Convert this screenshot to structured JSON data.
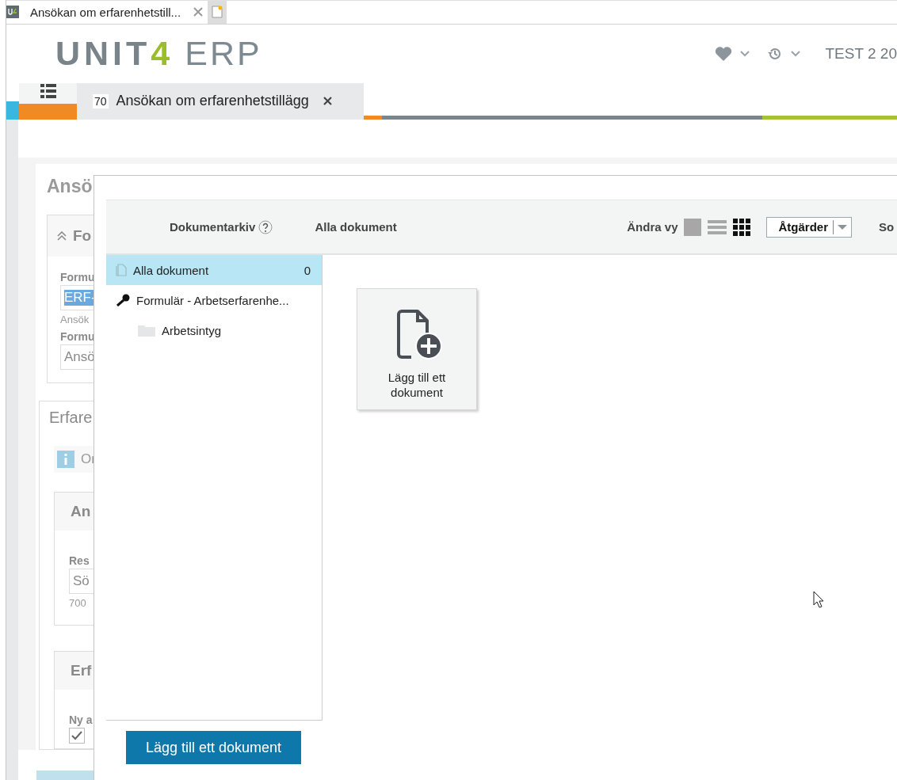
{
  "browser_tab": {
    "title": "Ansökan om erfarenhetstill..."
  },
  "header": {
    "logo": {
      "brand": "UNIT",
      "digit": "4",
      "product": "ERP"
    },
    "user": "TEST 2 20"
  },
  "nav_tabs": [
    {
      "number": "70",
      "label": "Ansökan om erfarenhetstillägg",
      "selected": true
    }
  ],
  "form": {
    "title": "Ansö",
    "section": "Fo",
    "fields": [
      {
        "label": "Formu",
        "value": "ERF-",
        "hint": "Ansök"
      },
      {
        "label": "Formu",
        "value": "Ansö"
      }
    ],
    "subsection": "Erfare",
    "info": "Or",
    "groups": [
      {
        "title": "An",
        "label": "Res",
        "value": "Sö",
        "hint": "700"
      },
      {
        "title": "Erf",
        "label": "Ny a",
        "checked": true
      }
    ]
  },
  "dialog": {
    "title": "Dokumentarkiv",
    "breadcrumb": "Alla dokument",
    "view_label": "Ändra vy",
    "views": [
      {
        "kind": "single",
        "selected": false
      },
      {
        "kind": "list",
        "selected": false
      },
      {
        "kind": "grid",
        "selected": true
      }
    ],
    "actions": "Åtgärder",
    "sort_label": "So",
    "tree": [
      {
        "kind": "all",
        "label": "Alla dokument",
        "count": "0",
        "selected": true
      },
      {
        "kind": "key",
        "label": "Formulär - Arbetserfarenhe...",
        "selected": false,
        "children": [
          {
            "kind": "folder",
            "label": "Arbetsintyg",
            "selected": false
          }
        ]
      }
    ],
    "tiles": [
      {
        "label": "Lägg till ett dokument"
      }
    ],
    "button": "Lägg till ett dokument"
  }
}
